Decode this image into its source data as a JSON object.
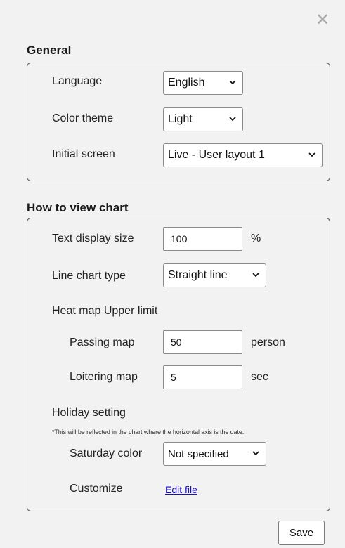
{
  "close_icon": "close-icon",
  "general": {
    "title": "General",
    "language": {
      "label": "Language",
      "value": "English"
    },
    "color_theme": {
      "label": "Color theme",
      "value": "Light"
    },
    "initial_screen": {
      "label": "Initial screen",
      "value": "Live - User layout 1"
    }
  },
  "chart": {
    "title": "How to view chart",
    "text_size": {
      "label": "Text display size",
      "value": "100",
      "unit": "%"
    },
    "line_type": {
      "label": "Line chart type",
      "value": "Straight line"
    },
    "heatmap": {
      "label": "Heat map Upper limit",
      "passing": {
        "label": "Passing map",
        "value": "50",
        "unit": "person"
      },
      "loitering": {
        "label": "Loitering map",
        "value": "5",
        "unit": "sec"
      }
    },
    "holiday": {
      "label": "Holiday setting",
      "note": "*This will be reflected in the chart where the horizontal axis is the date.",
      "saturday": {
        "label": "Saturday color",
        "value": "Not specified"
      },
      "customize": {
        "label": "Customize",
        "link": "Edit file"
      }
    }
  },
  "save_label": "Save"
}
